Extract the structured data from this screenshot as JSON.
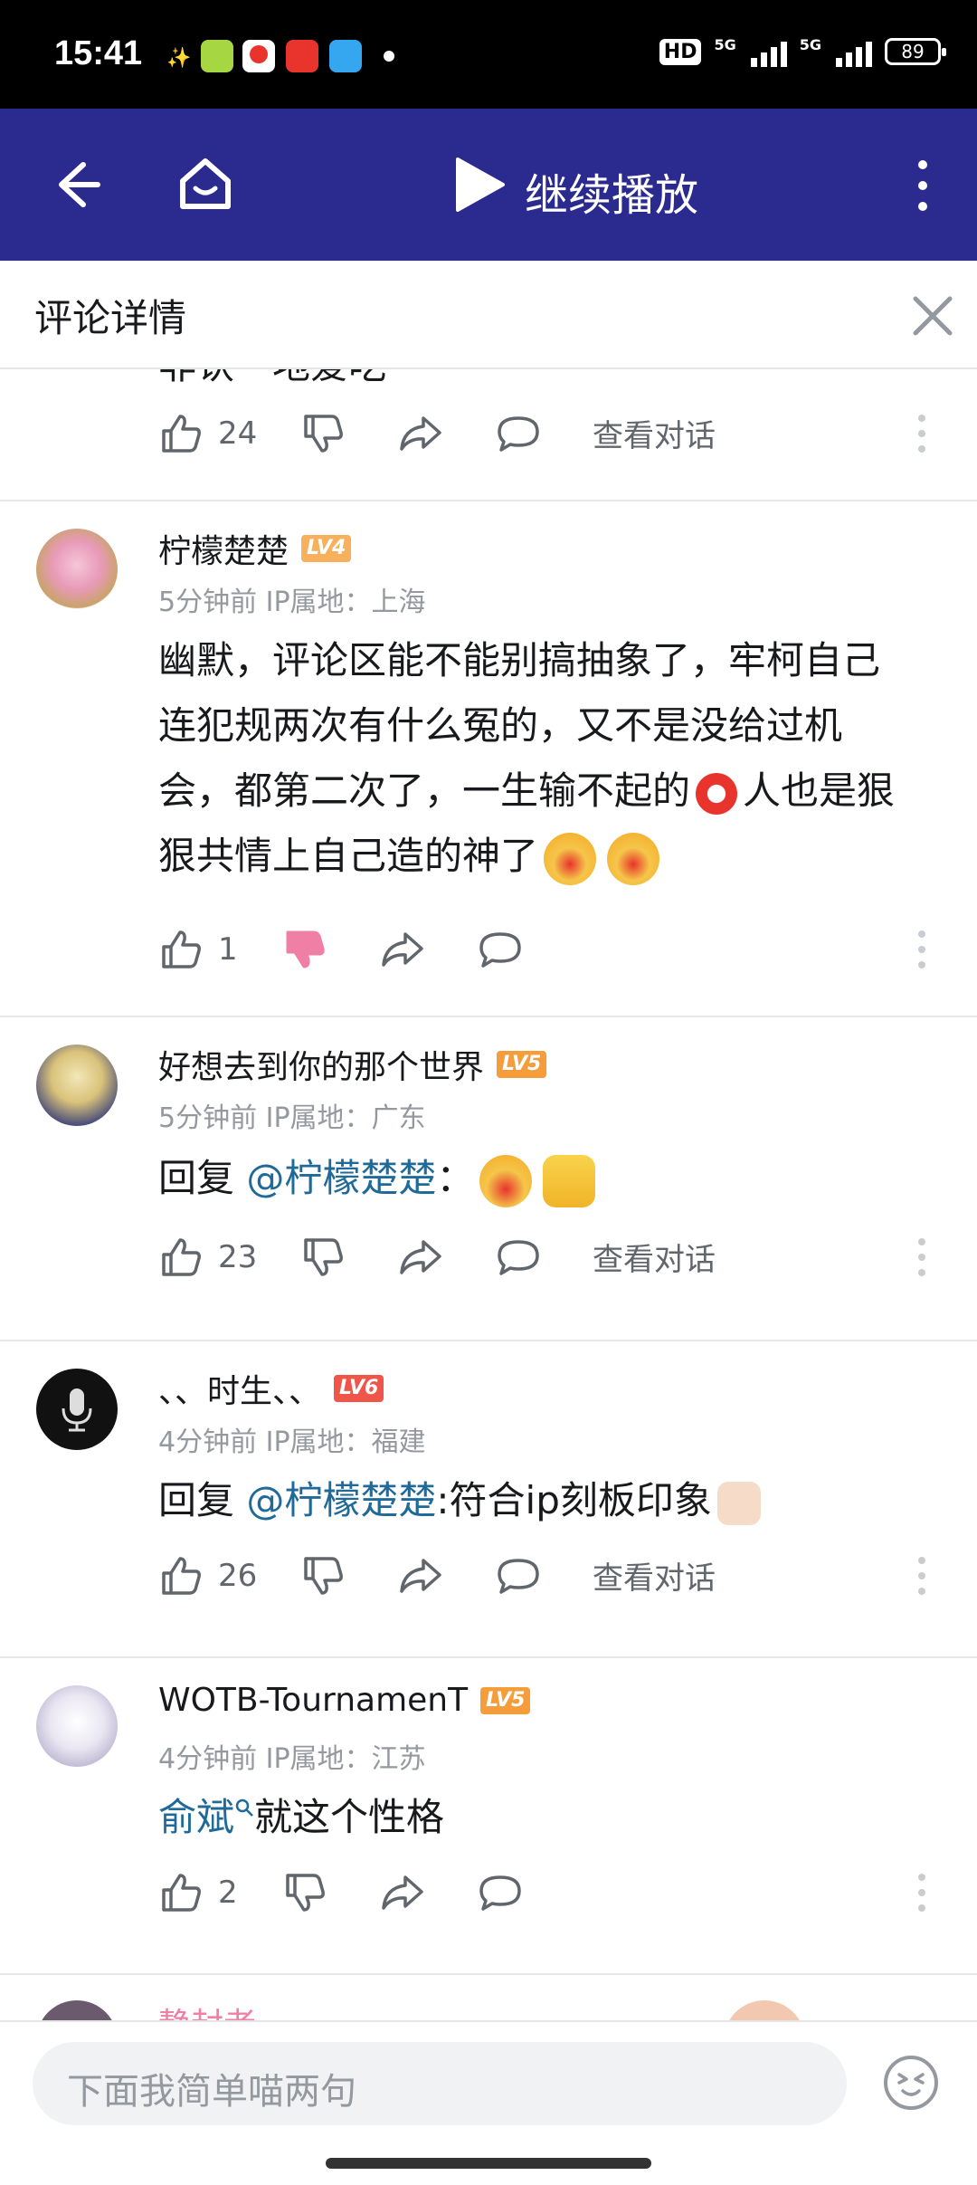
{
  "status": {
    "time": "15:41",
    "battery": "89",
    "hd": "HD",
    "net1": "5G",
    "net2": "5G"
  },
  "appbar": {
    "title": "继续播放"
  },
  "subhead": {
    "title": "评论详情"
  },
  "partial_top": {
    "text": "非认一地爱吃",
    "likes": "24",
    "view": "查看对话"
  },
  "comments": [
    {
      "user": "柠檬楚楚",
      "level": "LV4",
      "level_color": "#f7b05c",
      "meta": "5分钟前 IP属地：上海",
      "text_lines": [
        "幽默，评论区能不能别搞抽象了，牢柯自己",
        "连犯规两次有什么冤的，又不是没给过机",
        "会，都第二次了，一生输不起的",
        "人也是狠",
        "狠共情上自己造的神了"
      ],
      "likes": "1"
    },
    {
      "user": "好想去到你的那个世界",
      "level": "LV5",
      "level_color": "#f59d3b",
      "meta": "5分钟前 IP属地：广东",
      "reply_prefix": "回复 ",
      "mention": "@柠檬楚楚",
      "after": "：",
      "likes": "23",
      "view": "查看对话"
    },
    {
      "user": "、、时生、、",
      "level": "LV6",
      "level_color": "#f0554a",
      "meta": "4分钟前 IP属地：福建",
      "reply_prefix": "回复 ",
      "mention": "@柠檬楚楚",
      "after": ":符合ip刻板印象",
      "likes": "26",
      "view": "查看对话"
    },
    {
      "user": "WOTB-TournamenT",
      "level": "LV5",
      "level_color": "#f59d3b",
      "meta": "4分钟前 IP属地：江苏",
      "link": "俞斌",
      "after": "就这个性格",
      "likes": "2"
    }
  ],
  "partial_bottom": {
    "user": "静封者"
  },
  "composer": {
    "placeholder": "下面我简单喵两句"
  },
  "colors": {
    "accent": "#2a2a8f",
    "mention": "#1f6a98",
    "dislike_active": "#f07fa6"
  }
}
